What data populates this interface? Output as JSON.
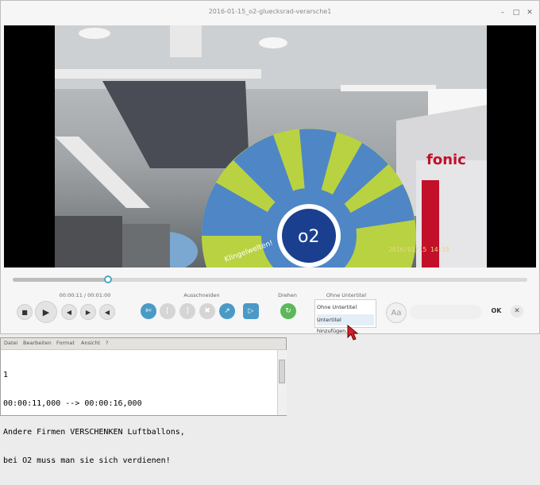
{
  "window": {
    "title": "2016-01-15_o2-gluecksrad-verarsche1",
    "minimize": "–",
    "maximize": "□",
    "close": "✕"
  },
  "playback": {
    "time": "00:00:11 / 00:01:00",
    "progress_fraction": 0.19
  },
  "sections": {
    "cut_label": "Ausschneiden",
    "rotate_label": "Drehen",
    "subtitle_label": "Ohne Untertitel"
  },
  "subtitle_menu": {
    "options": [
      "Ohne Untertitel",
      "Untertitel hinzufügen..."
    ]
  },
  "font_button": "Aa",
  "ok_button": "OK",
  "close_button": "✕",
  "video": {
    "brand_text": "fonic",
    "wheel_text": "Klingelwelten!",
    "wheel_logo": "o2",
    "timestamp": "2016/01/15 14:18"
  },
  "editor": {
    "menus": [
      "Datei",
      "Bearbeiten",
      "Format",
      "Ansicht",
      "?"
    ],
    "lines": [
      "1",
      "00:00:11,000 --> 00:00:16,000",
      "Andere Firmen VERSCHENKEN Luftballons,",
      "bei O2 muss man sie sich verdienen!"
    ]
  },
  "colors": {
    "accent": "#4aa8c6",
    "cut_tool": "#4a9ac7",
    "rotate": "#5cb85c"
  }
}
